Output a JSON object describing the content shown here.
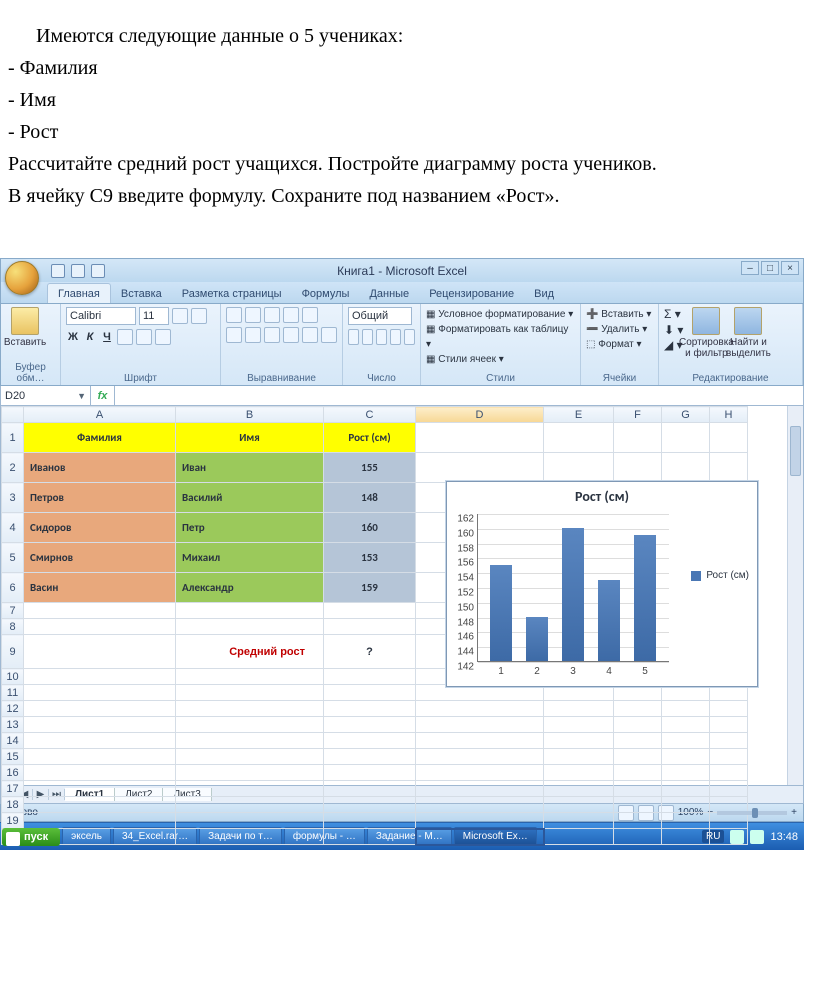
{
  "doc": {
    "p1": "Имеются следующие данные о 5 учениках:",
    "b1": "- Фамилия",
    "b2": "- Имя",
    "b3": "- Рост",
    "p2": "Рассчитайте средний рост учащихся. Постройте диаграмму роста учеников.",
    "p3": "В ячейку С9 введите формулу. Сохраните под названием «Рост»."
  },
  "window": {
    "title": "Книга1 - Microsoft Excel"
  },
  "tabs": [
    "Главная",
    "Вставка",
    "Разметка страницы",
    "Формулы",
    "Данные",
    "Рецензирование",
    "Вид"
  ],
  "ribbon": {
    "paste": "Вставить",
    "clipboard": "Буфер обм…",
    "font_name": "Calibri",
    "font_size": "11",
    "font_group": "Шрифт",
    "align_group": "Выравнивание",
    "number_fmt": "Общий",
    "number_group": "Число",
    "cond_fmt": "Условное форматирование",
    "fmt_table": "Форматировать как таблицу",
    "cell_styles": "Стили ячеек",
    "styles_group": "Стили",
    "insert": "Вставить",
    "delete": "Удалить",
    "format": "Формат",
    "cells_group": "Ячейки",
    "sort": "Сортировка и фильтр",
    "find": "Найти и выделить",
    "edit_group": "Редактирование"
  },
  "namebox": "D20",
  "columns": [
    "A",
    "B",
    "C",
    "D",
    "E",
    "F",
    "G",
    "H"
  ],
  "headers": {
    "A": "Фамилия",
    "B": "Имя",
    "C": "Рост (см)"
  },
  "rows": [
    {
      "fam": "Иванов",
      "name": "Иван",
      "rost": "155"
    },
    {
      "fam": "Петров",
      "name": "Василий",
      "rost": "148"
    },
    {
      "fam": "Сидоров",
      "name": "Петр",
      "rost": "160"
    },
    {
      "fam": "Смирнов",
      "name": "Михаил",
      "rost": "153"
    },
    {
      "fam": "Васин",
      "name": "Александр",
      "rost": "159"
    }
  ],
  "avg_label": "Средний рост",
  "avg_value": "?",
  "chart_data": {
    "type": "bar",
    "title": "Рост (см)",
    "categories": [
      "1",
      "2",
      "3",
      "4",
      "5"
    ],
    "values": [
      155,
      148,
      160,
      153,
      159
    ],
    "ylim": [
      142,
      162
    ],
    "yticks": [
      142,
      144,
      146,
      148,
      150,
      152,
      154,
      156,
      158,
      160,
      162
    ],
    "legend": "Рост (см)",
    "xlabel": "",
    "ylabel": ""
  },
  "sheet_tabs": [
    "Лист1",
    "Лист2",
    "Лист3"
  ],
  "status": {
    "ready": "Готово",
    "zoom": "100%"
  },
  "taskbar": {
    "start": "пуск",
    "items": [
      "",
      "",
      "эксель",
      "34_Excel.rar…",
      "Задачи по т…",
      "формулы - …",
      "Задание - М…",
      "Microsoft Ex…"
    ],
    "lang": "RU",
    "time": "13:48"
  }
}
